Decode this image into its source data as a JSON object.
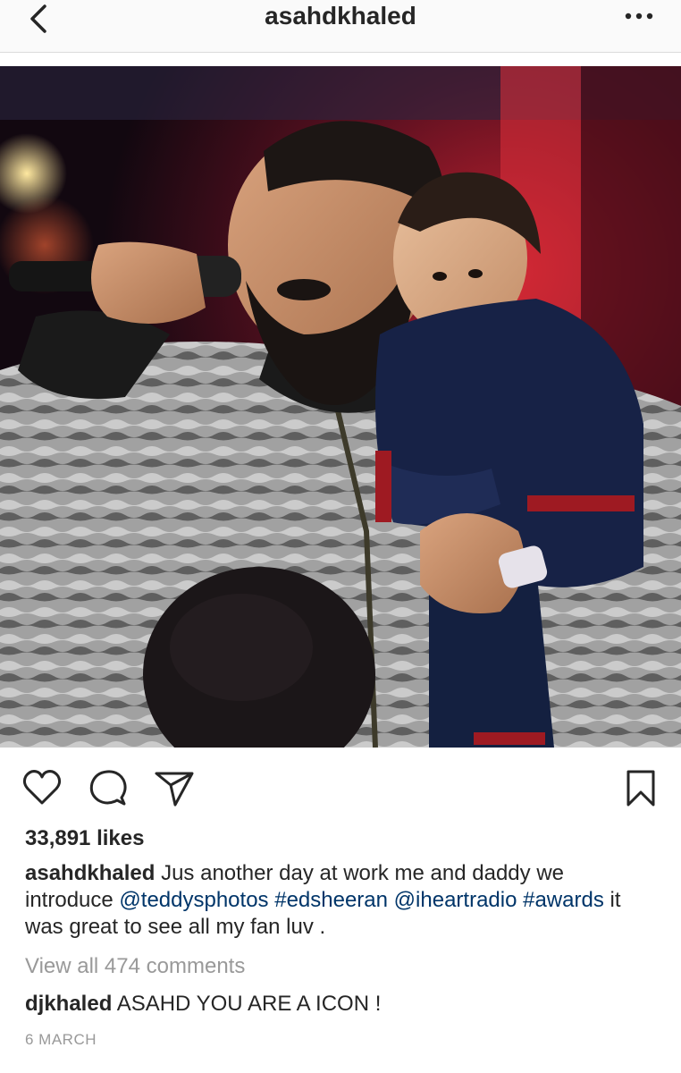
{
  "header": {
    "title": "asahdkhaled",
    "back_icon": "chevron-left-icon",
    "more_icon": "more-horizontal-icon"
  },
  "photo": {
    "subject": "post-photo"
  },
  "actions": {
    "like_icon": "heart-outline-icon",
    "comment_icon": "comment-bubble-icon",
    "share_icon": "paper-plane-icon",
    "save_icon": "bookmark-outline-icon"
  },
  "likes": "33,891 likes",
  "caption": {
    "username": "asahdkhaled",
    "text_1": " Jus another day at work me and daddy we introduce ",
    "tag_1": "@teddysphotos",
    "space_1": " ",
    "tag_2": "#edsheeran",
    "space_2": " ",
    "tag_3": "@iheartradio",
    "space_3": " ",
    "tag_4": "#awards",
    "text_2": " it was great to see all my fan luv ."
  },
  "view_comments": "View all 474 comments",
  "comment": {
    "username": "djkhaled",
    "text": " ASAHD YOU ARE A ICON !"
  },
  "date": "6 MARCH",
  "colors": {
    "text": "#262626",
    "link": "#003569",
    "muted": "#999999",
    "divider": "#dbdbdb"
  }
}
